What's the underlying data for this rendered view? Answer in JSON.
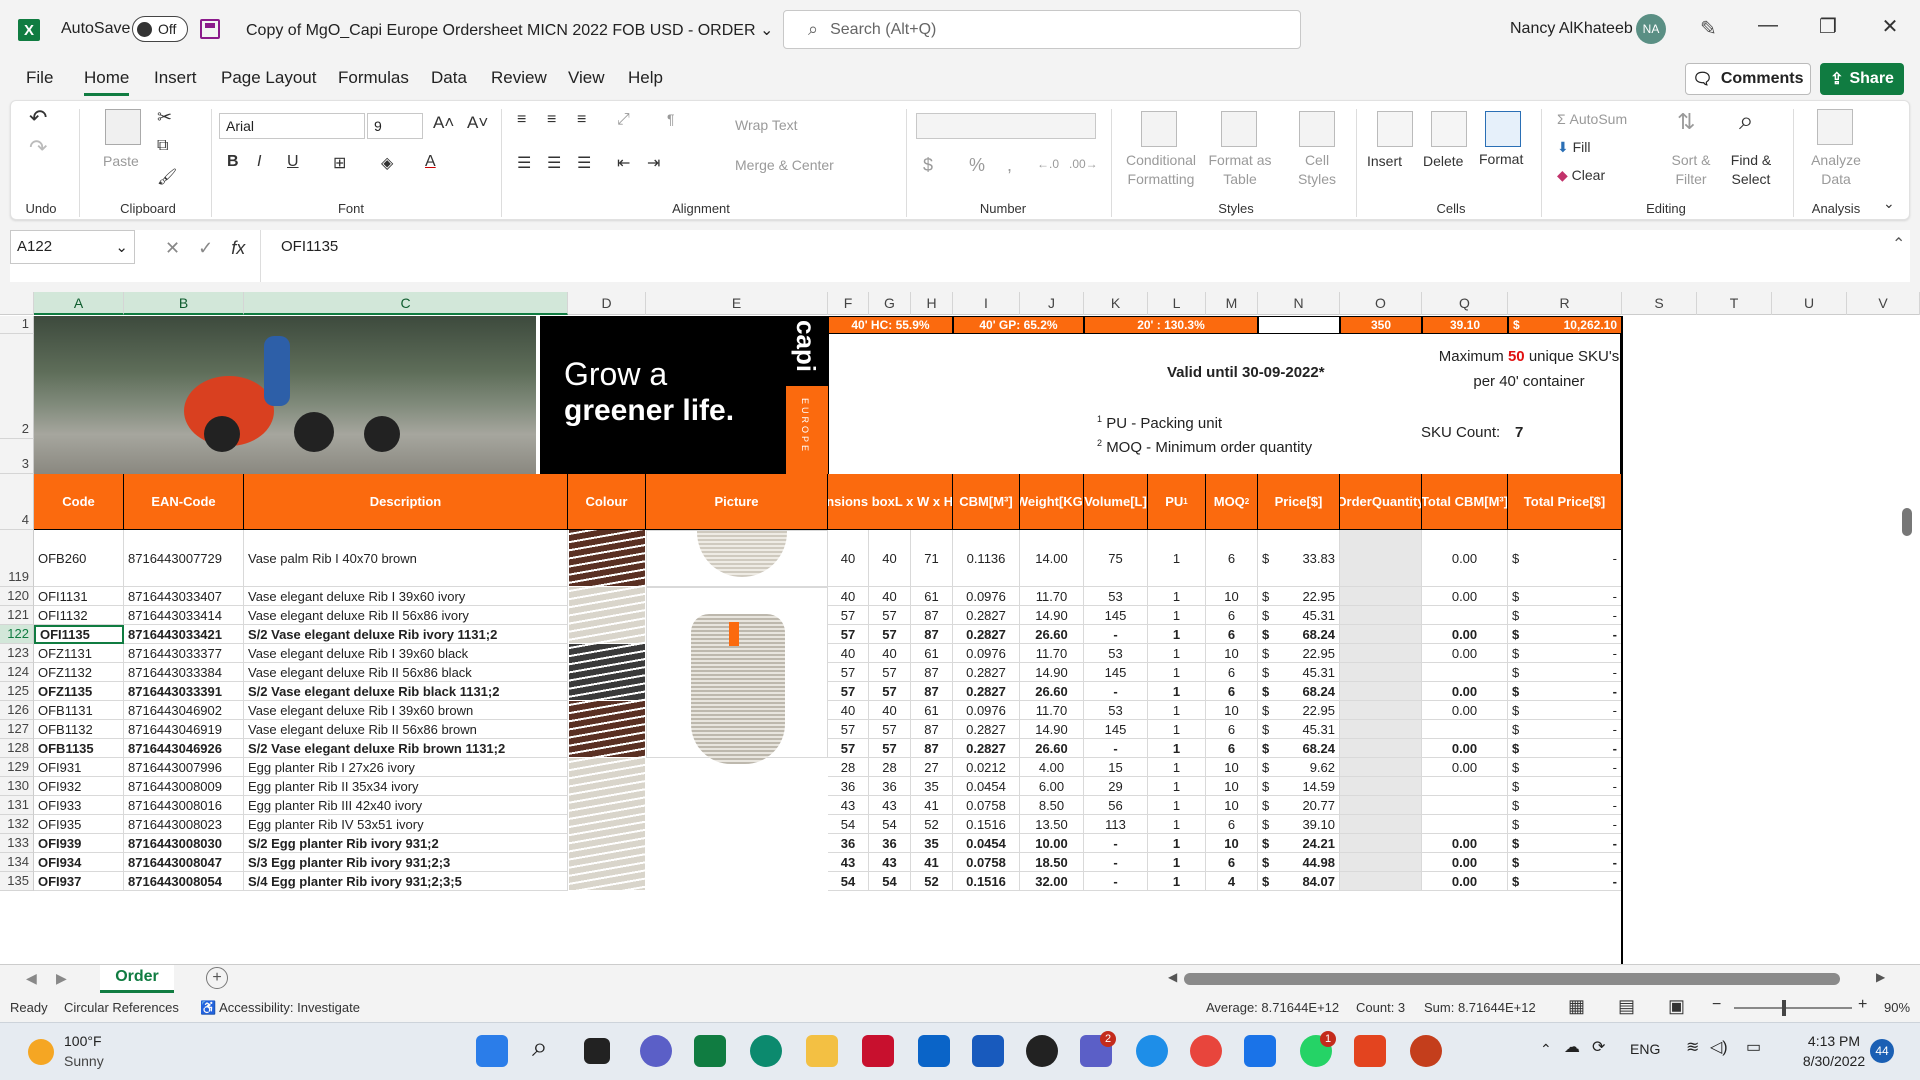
{
  "titlebar": {
    "app_icon": "excel-icon",
    "autosave_label": "AutoSave",
    "autosave_state": "Off",
    "doc_title": "Copy of MgO_Capi Europe Ordersheet MICN 2022 FOB USD - ORDER",
    "search_placeholder": "Search (Alt+Q)",
    "user_name": "Nancy AlKhateeb",
    "user_initials": "NA"
  },
  "menu": {
    "tabs": [
      "File",
      "Home",
      "Insert",
      "Page Layout",
      "Formulas",
      "Data",
      "Review",
      "View",
      "Help"
    ],
    "comments_label": "Comments",
    "share_label": "Share"
  },
  "ribbon": {
    "groups": [
      "Undo",
      "Clipboard",
      "Font",
      "Alignment",
      "Number",
      "Styles",
      "Cells",
      "Editing",
      "Analysis"
    ],
    "paste_label": "Paste",
    "font_name": "Arial",
    "font_size": "9",
    "wrap_text": "Wrap Text",
    "merge_center": "Merge & Center",
    "conditional_formatting": [
      "Conditional",
      "Formatting"
    ],
    "format_as_table": [
      "Format as",
      "Table"
    ],
    "cell_styles": [
      "Cell",
      "Styles"
    ],
    "insert": "Insert",
    "delete": "Delete",
    "format": "Format",
    "autosum": "AutoSum",
    "fill": "Fill",
    "clear": "Clear",
    "sort_filter": [
      "Sort &",
      "Filter"
    ],
    "find_select": [
      "Find &",
      "Select"
    ],
    "analyze_data": [
      "Analyze",
      "Data"
    ]
  },
  "formula": {
    "name_box": "A122",
    "value": "OFI1135"
  },
  "columns": [
    "A",
    "B",
    "C",
    "D",
    "E",
    "F",
    "G",
    "H",
    "I",
    "J",
    "K",
    "L",
    "M",
    "N",
    "O",
    "Q",
    "R",
    "S",
    "T",
    "U",
    "V"
  ],
  "top_band": {
    "hc": "40' HC: 55.9%",
    "gp": "40' GP: 65.2%",
    "twenty": "20' : 130.3%",
    "o1": "350",
    "q1": "39.10",
    "r1_cur": "$",
    "r1_val": "10,262.10"
  },
  "info": {
    "valid": "Valid until 30-09-2022*",
    "pu_note": "PU - Packing unit",
    "moq_note": "MOQ - Minimum order quantity",
    "max_sku_pre": "Maximum",
    "max_sku_num": "50",
    "max_sku_post": "unique SKU's",
    "max_sku_line2": "per 40' container",
    "sku_count_label": "SKU Count:",
    "sku_count": "7"
  },
  "banner": {
    "tagline1": "Grow a",
    "tagline2": "greener life.",
    "brand": "capi",
    "region": "EUROPE"
  },
  "headers": {
    "code": "Code",
    "ean": "EAN-Code",
    "desc": "Description",
    "colour": "Colour",
    "picture": "Picture",
    "dims": [
      "Dimensions box",
      "L x W x H [CM]"
    ],
    "cbm": [
      "CBM",
      "[M³]"
    ],
    "weight": [
      "Weight",
      "[KG]"
    ],
    "volume": [
      "Volume",
      "[L]"
    ],
    "pu": "PU",
    "moq": "MOQ",
    "price": [
      "Price",
      "[$]"
    ],
    "order": [
      "Order",
      "Quantity"
    ],
    "total_cbm": [
      "Total CBM",
      "[M³]"
    ],
    "total_price": [
      "Total Price",
      "[$]"
    ]
  },
  "row_numbers": [
    "1",
    "2",
    "3",
    "4",
    "119",
    "120",
    "121",
    "122",
    "123",
    "124",
    "125",
    "126",
    "127",
    "128",
    "129",
    "130",
    "131",
    "132",
    "133",
    "134",
    "135"
  ],
  "rows": [
    {
      "n": "119",
      "code": "OFB260",
      "ean": "8716443007729",
      "desc": "Vase palm Rib I 40x70 brown",
      "l": "40",
      "w": "40",
      "h": "71",
      "cbm": "0.1136",
      "kg": "14.00",
      "vol": "75",
      "pu": "1",
      "moq": "6",
      "price": "33.83",
      "tcbm": "0.00",
      "tp": "-",
      "bold": false,
      "colour": "brown"
    },
    {
      "n": "120",
      "code": "OFI1131",
      "ean": "8716443033407",
      "desc": "Vase elegant deluxe Rib I 39x60 ivory",
      "l": "40",
      "w": "40",
      "h": "61",
      "cbm": "0.0976",
      "kg": "11.70",
      "vol": "53",
      "pu": "1",
      "moq": "10",
      "price": "22.95",
      "tcbm": "0.00",
      "tp": "-",
      "bold": false,
      "colour": "ivory"
    },
    {
      "n": "121",
      "code": "OFI1132",
      "ean": "8716443033414",
      "desc": "Vase elegant deluxe Rib II 56x86 ivory",
      "l": "57",
      "w": "57",
      "h": "87",
      "cbm": "0.2827",
      "kg": "14.90",
      "vol": "145",
      "pu": "1",
      "moq": "6",
      "price": "45.31",
      "tcbm": "",
      "tp": "-",
      "bold": false,
      "colour": "ivory"
    },
    {
      "n": "122",
      "code": "OFI1135",
      "ean": "8716443033421",
      "desc": "S/2 Vase elegant deluxe Rib ivory 1131;2",
      "l": "57",
      "w": "57",
      "h": "87",
      "cbm": "0.2827",
      "kg": "26.60",
      "vol": "-",
      "pu": "1",
      "moq": "6",
      "price": "68.24",
      "tcbm": "0.00",
      "tp": "-",
      "bold": true,
      "colour": "ivory"
    },
    {
      "n": "123",
      "code": "OFZ1131",
      "ean": "8716443033377",
      "desc": "Vase elegant deluxe Rib I 39x60 black",
      "l": "40",
      "w": "40",
      "h": "61",
      "cbm": "0.0976",
      "kg": "11.70",
      "vol": "53",
      "pu": "1",
      "moq": "10",
      "price": "22.95",
      "tcbm": "0.00",
      "tp": "-",
      "bold": false,
      "colour": "black"
    },
    {
      "n": "124",
      "code": "OFZ1132",
      "ean": "8716443033384",
      "desc": "Vase elegant deluxe Rib II 56x86 black",
      "l": "57",
      "w": "57",
      "h": "87",
      "cbm": "0.2827",
      "kg": "14.90",
      "vol": "145",
      "pu": "1",
      "moq": "6",
      "price": "45.31",
      "tcbm": "",
      "tp": "-",
      "bold": false,
      "colour": "black"
    },
    {
      "n": "125",
      "code": "OFZ1135",
      "ean": "8716443033391",
      "desc": "S/2 Vase elegant deluxe Rib black 1131;2",
      "l": "57",
      "w": "57",
      "h": "87",
      "cbm": "0.2827",
      "kg": "26.60",
      "vol": "-",
      "pu": "1",
      "moq": "6",
      "price": "68.24",
      "tcbm": "0.00",
      "tp": "-",
      "bold": true,
      "colour": "black"
    },
    {
      "n": "126",
      "code": "OFB1131",
      "ean": "8716443046902",
      "desc": "Vase elegant deluxe Rib I 39x60 brown",
      "l": "40",
      "w": "40",
      "h": "61",
      "cbm": "0.0976",
      "kg": "11.70",
      "vol": "53",
      "pu": "1",
      "moq": "10",
      "price": "22.95",
      "tcbm": "0.00",
      "tp": "-",
      "bold": false,
      "colour": "brown"
    },
    {
      "n": "127",
      "code": "OFB1132",
      "ean": "8716443046919",
      "desc": "Vase elegant deluxe Rib II 56x86 brown",
      "l": "57",
      "w": "57",
      "h": "87",
      "cbm": "0.2827",
      "kg": "14.90",
      "vol": "145",
      "pu": "1",
      "moq": "6",
      "price": "45.31",
      "tcbm": "",
      "tp": "-",
      "bold": false,
      "colour": "brown"
    },
    {
      "n": "128",
      "code": "OFB1135",
      "ean": "8716443046926",
      "desc": "S/2 Vase elegant deluxe Rib brown 1131;2",
      "l": "57",
      "w": "57",
      "h": "87",
      "cbm": "0.2827",
      "kg": "26.60",
      "vol": "-",
      "pu": "1",
      "moq": "6",
      "price": "68.24",
      "tcbm": "0.00",
      "tp": "-",
      "bold": true,
      "colour": "brown"
    },
    {
      "n": "129",
      "code": "OFI931",
      "ean": "8716443007996",
      "desc": "Egg planter Rib I 27x26 ivory",
      "l": "28",
      "w": "28",
      "h": "27",
      "cbm": "0.0212",
      "kg": "4.00",
      "vol": "15",
      "pu": "1",
      "moq": "10",
      "price": "9.62",
      "tcbm": "0.00",
      "tp": "-",
      "bold": false,
      "colour": "ivory"
    },
    {
      "n": "130",
      "code": "OFI932",
      "ean": "8716443008009",
      "desc": "Egg planter Rib II 35x34 ivory",
      "l": "36",
      "w": "36",
      "h": "35",
      "cbm": "0.0454",
      "kg": "6.00",
      "vol": "29",
      "pu": "1",
      "moq": "10",
      "price": "14.59",
      "tcbm": "",
      "tp": "-",
      "bold": false,
      "colour": "ivory"
    },
    {
      "n": "131",
      "code": "OFI933",
      "ean": "8716443008016",
      "desc": "Egg planter Rib III 42x40 ivory",
      "l": "43",
      "w": "43",
      "h": "41",
      "cbm": "0.0758",
      "kg": "8.50",
      "vol": "56",
      "pu": "1",
      "moq": "10",
      "price": "20.77",
      "tcbm": "",
      "tp": "-",
      "bold": false,
      "colour": "ivory"
    },
    {
      "n": "132",
      "code": "OFI935",
      "ean": "8716443008023",
      "desc": "Egg planter Rib IV 53x51 ivory",
      "l": "54",
      "w": "54",
      "h": "52",
      "cbm": "0.1516",
      "kg": "13.50",
      "vol": "113",
      "pu": "1",
      "moq": "6",
      "price": "39.10",
      "tcbm": "",
      "tp": "-",
      "bold": false,
      "colour": "ivory"
    },
    {
      "n": "133",
      "code": "OFI939",
      "ean": "8716443008030",
      "desc": "S/2 Egg planter Rib ivory 931;2",
      "l": "36",
      "w": "36",
      "h": "35",
      "cbm": "0.0454",
      "kg": "10.00",
      "vol": "-",
      "pu": "1",
      "moq": "10",
      "price": "24.21",
      "tcbm": "0.00",
      "tp": "-",
      "bold": true,
      "colour": "ivory"
    },
    {
      "n": "134",
      "code": "OFI934",
      "ean": "8716443008047",
      "desc": "S/3 Egg planter Rib ivory 931;2;3",
      "l": "43",
      "w": "43",
      "h": "41",
      "cbm": "0.0758",
      "kg": "18.50",
      "vol": "-",
      "pu": "1",
      "moq": "6",
      "price": "44.98",
      "tcbm": "0.00",
      "tp": "-",
      "bold": true,
      "colour": "ivory"
    },
    {
      "n": "135",
      "code": "OFI937",
      "ean": "8716443008054",
      "desc": "S/4 Egg planter Rib ivory 931;2;3;5",
      "l": "54",
      "w": "54",
      "h": "52",
      "cbm": "0.1516",
      "kg": "32.00",
      "vol": "-",
      "pu": "1",
      "moq": "4",
      "price": "84.07",
      "tcbm": "0.00",
      "tp": "-",
      "bold": true,
      "colour": "ivory"
    }
  ],
  "currency": "$",
  "sheet": {
    "active_tab": "Order"
  },
  "status": {
    "ready": "Ready",
    "circular": "Circular References",
    "accessibility": "Accessibility: Investigate",
    "average": "Average: 8.71644E+12",
    "count": "Count: 3",
    "sum": "Sum: 8.71644E+12",
    "zoom": "90%"
  },
  "taskbar": {
    "temp": "100°F",
    "weather": "Sunny",
    "lang": "ENG",
    "time": "4:13 PM",
    "date": "8/30/2022",
    "notif": "44",
    "teams_badge": "2",
    "whatsapp_badge": "1"
  },
  "colors": {
    "orange": "#fb6a0e",
    "excel_green": "#107c41",
    "brown_swatch": "#5a3023",
    "ivory_swatch": "#d9d5cb",
    "black_swatch": "#3a3a3a"
  }
}
